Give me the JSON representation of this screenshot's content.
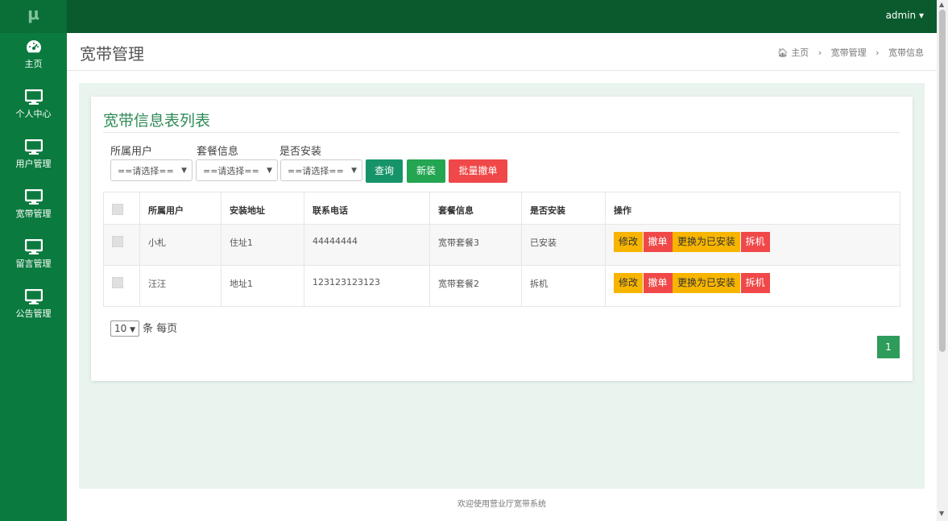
{
  "app": {
    "logo": "μ"
  },
  "topbar": {
    "user": "admin ▾"
  },
  "sidebar": {
    "items": [
      {
        "label": "主页",
        "icon": "dashboard-icon"
      },
      {
        "label": "个人中心",
        "icon": "monitor-icon"
      },
      {
        "label": "用户管理",
        "icon": "monitor-icon"
      },
      {
        "label": "宽带管理",
        "icon": "monitor-icon"
      },
      {
        "label": "留言管理",
        "icon": "monitor-icon"
      },
      {
        "label": "公告管理",
        "icon": "monitor-icon"
      }
    ]
  },
  "header": {
    "title": "宽带管理",
    "breadcrumb": [
      "主页",
      "宽带管理",
      "宽带信息"
    ],
    "home_icon": "home-icon"
  },
  "card": {
    "title": "宽带信息表列表"
  },
  "filters": [
    {
      "label": "所属用户",
      "value": "==请选择=="
    },
    {
      "label": "套餐信息",
      "value": "==请选择=="
    },
    {
      "label": "是否安装",
      "value": "==请选择=="
    }
  ],
  "buttons": {
    "query": "查询",
    "add": "新装",
    "batch_cancel": "批量撤单"
  },
  "table": {
    "headers": [
      "所属用户",
      "安装地址",
      "联系电话",
      "套餐信息",
      "是否安装",
      "操作"
    ],
    "rows": [
      {
        "user": "小札",
        "address": "住址1",
        "phone": "44444444",
        "package": "宽带套餐3",
        "installed": "已安装"
      },
      {
        "user": "汪汪",
        "address": "地址1",
        "phone": "123123123123",
        "package": "宽带套餐2",
        "installed": "拆机"
      }
    ],
    "actions": {
      "edit": "修改",
      "cancel": "撤单",
      "set_installed": "更换为已安装",
      "remove": "拆机"
    }
  },
  "pagination": {
    "page_size": "10",
    "page_size_suffix": "条 每页",
    "current_page": "1"
  },
  "footer": {
    "text": "欢迎使用营业厅宽带系统"
  },
  "colors": {
    "sidebar": "#0b7a3e",
    "topbar": "#0a5a2d",
    "primary": "#2e9c5a",
    "warning": "#f7b500",
    "danger": "#f04848"
  }
}
